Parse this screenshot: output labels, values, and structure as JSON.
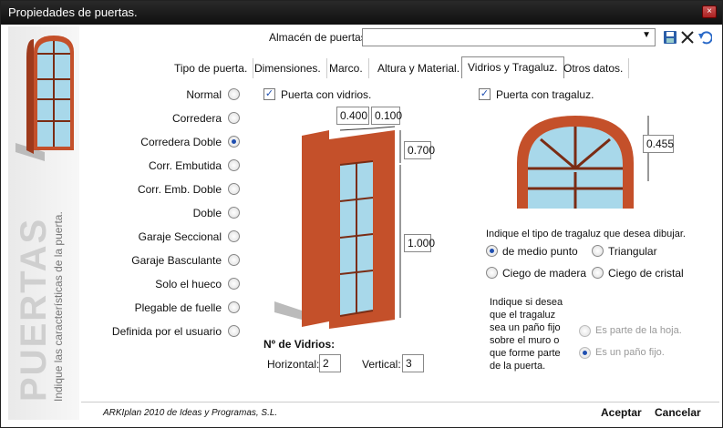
{
  "window": {
    "title": "Propiedades de puertas.",
    "close": "×"
  },
  "left": {
    "big": "PUERTAS",
    "small": "Indique las características de la puerta."
  },
  "store": {
    "label": "Almacén de puertas",
    "value": ""
  },
  "tabs": [
    "Tipo de puerta.",
    "Dimensiones.",
    "Marco.",
    "Altura y Material.",
    "Vidrios y Tragaluz.",
    "Otros datos."
  ],
  "types": [
    "Normal",
    "Corredera",
    "Corredera Doble",
    "Corr. Embutida",
    "Corr. Emb. Doble",
    "Doble",
    "Garaje Seccional",
    "Garaje Basculante",
    "Solo el hueco",
    "Plegable de fuelle",
    "Definida por el usuario"
  ],
  "vidrios": {
    "checkbox": "Puerta con vidrios.",
    "dims": {
      "a": "0.400",
      "b": "0.100",
      "c": "0.700",
      "d": "1.000"
    },
    "count_title": "Nº de Vidrios:",
    "horizontal_label": "Horizontal:",
    "horizontal": "2",
    "vertical_label": "Vertical:",
    "vertical": "3"
  },
  "tragaluz": {
    "checkbox": "Puerta con tragaluz.",
    "height": "0.455",
    "type_prompt": "Indique el tipo de tragaluz que desea dibujar.",
    "options": [
      "de medio punto",
      "Triangular",
      "Ciego de madera",
      "Ciego de cristal"
    ],
    "panel_prompt": "Indique si desea que el tragaluz sea un paño fijo sobre el muro o que forme parte de la puerta.",
    "panel_options": [
      "Es parte de la hoja.",
      "Es un paño fijo."
    ]
  },
  "footer": {
    "credit": "ARKIplan 2010 de Ideas y Programas, S.L.",
    "accept": "Aceptar",
    "cancel": "Cancelar"
  },
  "colors": {
    "door": "#c4502a",
    "glass": "#a8d8ea"
  }
}
